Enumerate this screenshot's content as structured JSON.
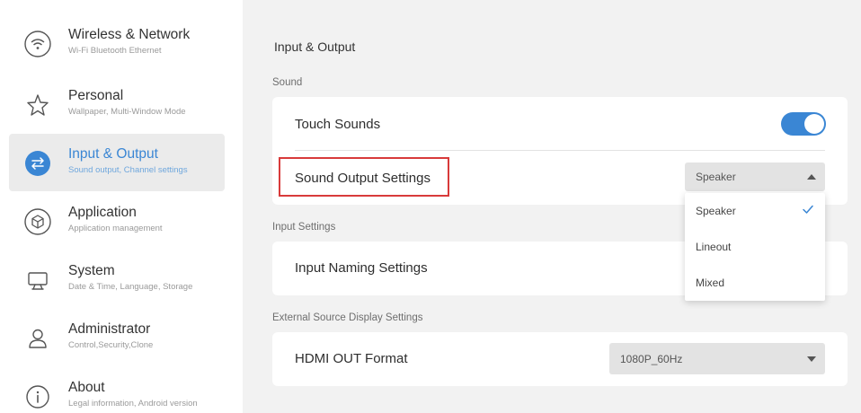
{
  "sidebar": {
    "items": [
      {
        "title": "Wireless & Network",
        "subtitle": "Wi-Fi Bluetooth Ethernet",
        "icon": "wifi-icon"
      },
      {
        "title": "Personal",
        "subtitle": "Wallpaper, Multi-Window Mode",
        "icon": "star-icon"
      },
      {
        "title": "Input & Output",
        "subtitle": "Sound output, Channel settings",
        "icon": "swap-arrows-icon",
        "active": true
      },
      {
        "title": "Application",
        "subtitle": "Application management",
        "icon": "cube-icon"
      },
      {
        "title": "System",
        "subtitle": "Date & Time, Language, Storage",
        "icon": "monitor-icon"
      },
      {
        "title": "Administrator",
        "subtitle": "Control,Security,Clone",
        "icon": "user-icon"
      },
      {
        "title": "About",
        "subtitle": "Legal information, Android version",
        "icon": "info-icon"
      }
    ]
  },
  "main": {
    "title": "Input & Output",
    "sound": {
      "label": "Sound",
      "touch_sounds": {
        "label": "Touch Sounds",
        "enabled": true
      },
      "output": {
        "label": "Sound Output Settings",
        "value": "Speaker"
      }
    },
    "input_settings": {
      "label": "Input Settings",
      "naming": {
        "label": "Input Naming Settings"
      }
    },
    "external": {
      "label": "External Source Display Settings",
      "hdmi": {
        "label": "HDMI OUT Format",
        "value": "1080P_60Hz"
      }
    }
  },
  "dropdown": {
    "options": [
      "Speaker",
      "Lineout",
      "Mixed"
    ],
    "selected": "Speaker"
  },
  "colors": {
    "accent": "#3a86d4",
    "highlight": "#d83a3a"
  }
}
